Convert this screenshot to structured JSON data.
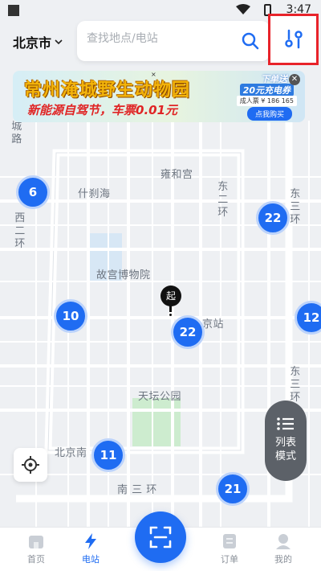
{
  "status_bar": {
    "time": "3:47"
  },
  "header": {
    "city": "北京市",
    "search_placeholder": "查找地点/电站"
  },
  "banner": {
    "title": "常州淹城野生动物园",
    "subtitle": "新能源自驾节，车票0.01元",
    "promo_line1": "下单送",
    "promo_line2": "20元充电券",
    "price": "成人票 ¥ 186 165",
    "buy": "点我购买",
    "x_mark": "×"
  },
  "map_labels": {
    "chengzhi": "城路",
    "yonghegong": "雍和宫",
    "shichahai": "什刹海",
    "dongerhuan": "东二环",
    "dongsanhuan_top": "东三环",
    "xierhuan": "西二环",
    "gugong": "故宫博物院",
    "zhan": "京站",
    "tiantan": "天坛公园",
    "dongsanhuan_bottom": "东三环",
    "beijingnan": "北京南",
    "nansanhuan": "南 三 环"
  },
  "clusters": [
    {
      "id": "c1",
      "count": "6"
    },
    {
      "id": "c2",
      "count": "22"
    },
    {
      "id": "c3",
      "count": "10"
    },
    {
      "id": "c4",
      "count": "22"
    },
    {
      "id": "c5",
      "count": "12"
    },
    {
      "id": "c6",
      "count": "11"
    },
    {
      "id": "c7",
      "count": "21"
    }
  ],
  "pin": {
    "label": "起"
  },
  "list_mode": {
    "label": "列表模式"
  },
  "nav": {
    "home": "首页",
    "station": "电站",
    "orders": "订单",
    "mine": "我的"
  },
  "colors": {
    "accent": "#1f6cf2",
    "highlight_border": "#e8232a"
  }
}
